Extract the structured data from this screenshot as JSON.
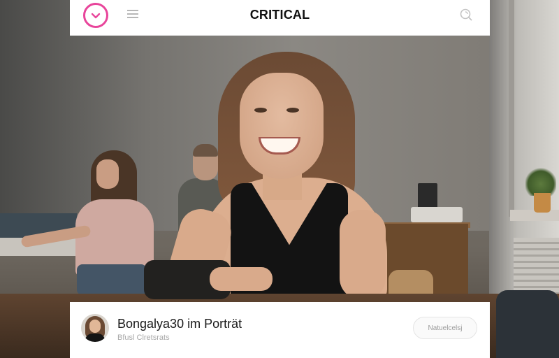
{
  "app": {
    "brand": "CRITICAL",
    "logo_icon": "heart-chevron-icon",
    "accent_color": "#e8459b"
  },
  "header": {
    "menu_icon": "hamburger-menu-icon",
    "search_icon": "search-icon"
  },
  "post": {
    "title": "Bongalya30 im Porträt",
    "subtitle": "Bfusl Clretsrats",
    "action_label": "Natuelcelsj"
  }
}
